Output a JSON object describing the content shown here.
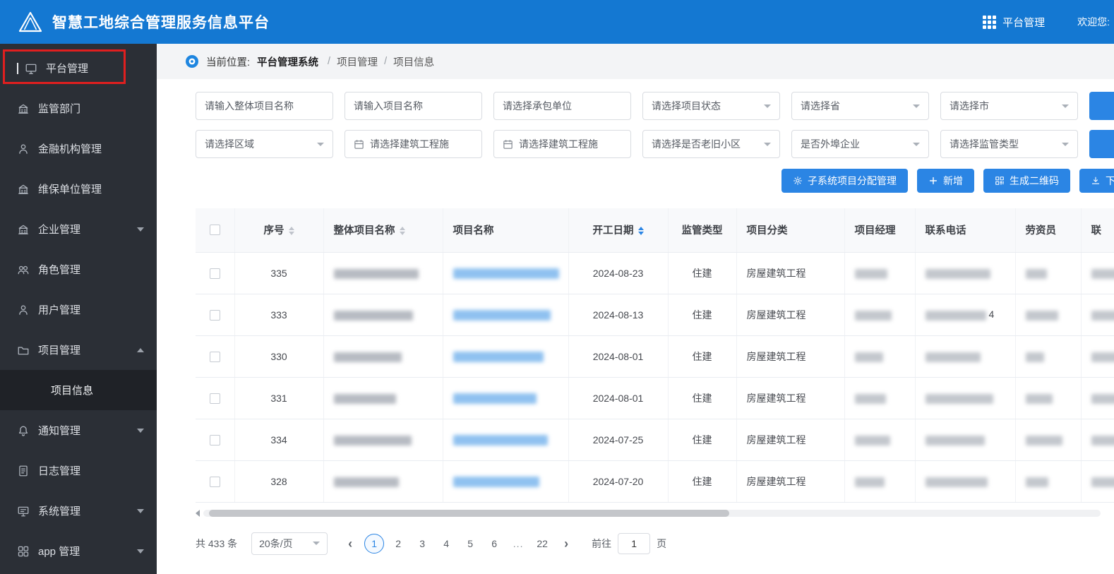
{
  "colors": {
    "header_blue": "#1478d2",
    "accent_blue": "#2b85e4",
    "sidebar_dark": "#2b2f36",
    "annotation_red": "#e01f1f"
  },
  "header": {
    "title": "智慧工地综合管理服务信息平台",
    "nav_label": "平台管理",
    "welcome": "欢迎您:"
  },
  "sidebar": {
    "items": [
      {
        "key": "platform-management",
        "label": "平台管理",
        "icon": "monitor",
        "highlighted": true
      },
      {
        "key": "supervision-department",
        "label": "监管部门",
        "icon": "bank"
      },
      {
        "key": "financial-institution-management",
        "label": "金融机构管理",
        "icon": "user"
      },
      {
        "key": "maintenance-unit-management",
        "label": "维保单位管理",
        "icon": "bank"
      },
      {
        "key": "enterprise-management",
        "label": "企业管理",
        "icon": "bank",
        "expandable": true
      },
      {
        "key": "role-management",
        "label": "角色管理",
        "icon": "team"
      },
      {
        "key": "user-management",
        "label": "用户管理",
        "icon": "user"
      },
      {
        "key": "project-management",
        "label": "项目管理",
        "icon": "project",
        "expandable": true,
        "expanded": true,
        "children": [
          {
            "key": "project-info",
            "label": "项目信息",
            "active": true
          }
        ]
      },
      {
        "key": "notification-management",
        "label": "通知管理",
        "icon": "bell",
        "expandable": true
      },
      {
        "key": "log-management",
        "label": "日志管理",
        "icon": "doc"
      },
      {
        "key": "system-management",
        "label": "系统管理",
        "icon": "system",
        "expandable": true
      },
      {
        "key": "app-management",
        "label": "app 管理",
        "icon": "app",
        "expandable": true
      }
    ]
  },
  "breadcrumb": {
    "prefix": "当前位置:",
    "root": "平台管理系统",
    "separator": "/",
    "items": [
      "项目管理",
      "项目信息"
    ]
  },
  "filters": {
    "row1": [
      {
        "key": "overall-project-name",
        "type": "input",
        "placeholder": "请输入整体项目名称"
      },
      {
        "key": "project-name",
        "type": "input",
        "placeholder": "请输入项目名称"
      },
      {
        "key": "contractor",
        "type": "input",
        "placeholder": "请选择承包单位"
      },
      {
        "key": "project-status",
        "type": "select",
        "placeholder": "请选择项目状态"
      },
      {
        "key": "province",
        "type": "select",
        "placeholder": "请选择省"
      },
      {
        "key": "city",
        "type": "select",
        "placeholder": "请选择市"
      }
    ],
    "row2": [
      {
        "key": "region",
        "type": "select",
        "placeholder": "请选择区域"
      },
      {
        "key": "construction-date-start",
        "type": "date",
        "placeholder": "请选择建筑工程施"
      },
      {
        "key": "construction-date-end",
        "type": "date",
        "placeholder": "请选择建筑工程施"
      },
      {
        "key": "old-community",
        "type": "select",
        "placeholder": "请选择是否老旧小区"
      },
      {
        "key": "external-enterprise",
        "type": "select",
        "placeholder": "是否外埠企业"
      },
      {
        "key": "supervision-type",
        "type": "select",
        "placeholder": "请选择监管类型"
      }
    ]
  },
  "actions": [
    {
      "key": "subsystem-assign",
      "icon": "gear",
      "label": "子系统项目分配管理"
    },
    {
      "key": "add",
      "icon": "plus",
      "label": "新增"
    },
    {
      "key": "generate-qrcode",
      "icon": "qr",
      "label": "生成二维码"
    },
    {
      "key": "download",
      "icon": "download",
      "label": "下载"
    }
  ],
  "table": {
    "columns": [
      {
        "key": "select",
        "type": "checkbox",
        "label": ""
      },
      {
        "key": "seq",
        "label": "序号",
        "sort": "gray"
      },
      {
        "key": "overall-project-name",
        "label": "整体项目名称",
        "sort": "gray"
      },
      {
        "key": "project-name",
        "label": "项目名称"
      },
      {
        "key": "start-date",
        "label": "开工日期",
        "sort": "blue"
      },
      {
        "key": "supervision-type",
        "label": "监管类型"
      },
      {
        "key": "project-category",
        "label": "项目分类"
      },
      {
        "key": "project-manager",
        "label": "项目经理"
      },
      {
        "key": "contact-phone",
        "label": "联系电话"
      },
      {
        "key": "labor-officer",
        "label": "劳资员"
      },
      {
        "key": "clipped",
        "label": "联"
      }
    ],
    "rows": [
      {
        "seq": "335",
        "start_date": "2024-08-23",
        "supervision": "住建",
        "category": "房屋建筑工程",
        "redacted": true
      },
      {
        "seq": "333",
        "start_date": "2024-08-13",
        "supervision": "住建",
        "category": "房屋建筑工程",
        "redacted": true,
        "phone_suffix": "4"
      },
      {
        "seq": "330",
        "start_date": "2024-08-01",
        "supervision": "住建",
        "category": "房屋建筑工程",
        "redacted": true
      },
      {
        "seq": "331",
        "start_date": "2024-08-01",
        "supervision": "住建",
        "category": "房屋建筑工程",
        "redacted": true
      },
      {
        "seq": "334",
        "start_date": "2024-07-25",
        "supervision": "住建",
        "category": "房屋建筑工程",
        "redacted": true
      },
      {
        "seq": "328",
        "start_date": "2024-07-20",
        "supervision": "住建",
        "category": "房屋建筑工程",
        "redacted": true
      }
    ]
  },
  "pagination": {
    "total": "共 433 条",
    "page_size": "20条/页",
    "prev": "‹",
    "next": "›",
    "pages": [
      "1",
      "2",
      "3",
      "4",
      "5",
      "6",
      "...",
      "22"
    ],
    "active": "1",
    "goto_label": "前往",
    "goto_value": "1",
    "goto_unit": "页"
  }
}
